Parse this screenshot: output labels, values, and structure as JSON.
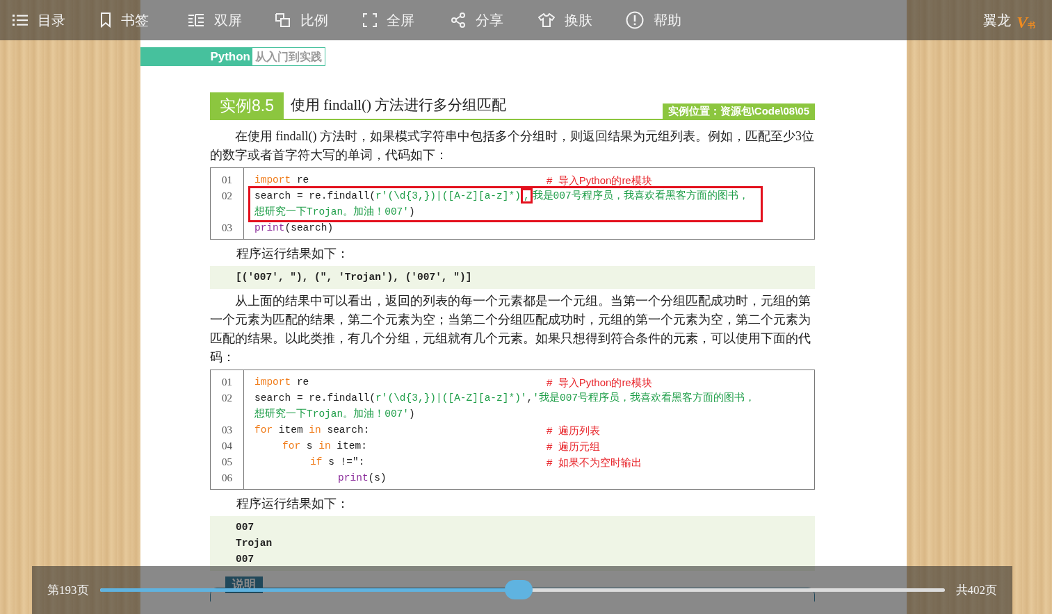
{
  "toolbar": {
    "items": [
      {
        "kind": "list",
        "label": "目录"
      },
      {
        "kind": "bookmark",
        "label": "书签"
      },
      {
        "kind": "columns",
        "label": "双屏"
      },
      {
        "kind": "squares",
        "label": "比例"
      },
      {
        "kind": "corners",
        "label": "全屏"
      },
      {
        "kind": "share",
        "label": "分享"
      },
      {
        "kind": "shirt",
        "label": "换肤"
      },
      {
        "kind": "alert",
        "label": "帮助"
      }
    ],
    "brand": "翼龙",
    "logo": {
      "letter": "V",
      "sub": "书"
    }
  },
  "page": {
    "header": {
      "book_en": "Python",
      "book_cn": "从入门到实践"
    },
    "example": {
      "label": "实例8.5",
      "title": "使用 findall() 方法进行多分组匹配",
      "location": "实例位置：资源包\\Code\\08\\05"
    },
    "blocks": [
      {
        "kind": "paragraph",
        "text": "在使用 findall() 方法时，如果模式字符串中包括多个分组时，则返回结果为元组列表。例如，匹配至少3位的数字或者首字符大写的单词，代码如下："
      },
      {
        "kind": "code",
        "lines": [
          {
            "number": "01",
            "tokens": [
              {
                "text": "import",
                "kind": "keyword"
              },
              {
                "text": " re",
                "kind": "plain"
              }
            ],
            "comment": "#  导入Python的re模块"
          },
          {
            "number": "02",
            "highlighted": true,
            "tokens": [
              {
                "text": "search = re.findall(",
                "kind": "plain"
              },
              {
                "text": "r'(\\d{3,})|([A-Z][a-z]*)",
                "kind": "string"
              },
              {
                "text": ",",
                "kind": "string",
                "marked": true
              },
              {
                "text": "我是007号程序员，我喜欢看黑客方面的图书，",
                "kind": "string"
              }
            ],
            "continuation": [
              {
                "text": "想研究一下Trojan。加油！007'",
                "kind": "string"
              },
              {
                "text": ")",
                "kind": "plain"
              }
            ]
          },
          {
            "number": "03",
            "tokens": [
              {
                "text": "print",
                "kind": "builtin"
              },
              {
                "text": "(search)",
                "kind": "plain"
              }
            ]
          }
        ]
      },
      {
        "kind": "label",
        "text": "程序运行结果如下："
      },
      {
        "kind": "output",
        "lines": [
          "[('007', \"), (\", 'Trojan'), ('007', \")]"
        ]
      },
      {
        "kind": "paragraph",
        "text": "从上面的结果中可以看出，返回的列表的每一个元素都是一个元组。当第一个分组匹配成功时，元组的第一个元素为匹配的结果，第二个元素为空；当第二个分组匹配成功时，元组的第一个元素为空，第二个元素为匹配的结果。以此类推，有几个分组，元组就有几个元素。如果只想得到符合条件的元素，可以使用下面的代码："
      },
      {
        "kind": "code",
        "lines": [
          {
            "number": "01",
            "tokens": [
              {
                "text": "import",
                "kind": "keyword"
              },
              {
                "text": " re",
                "kind": "plain"
              }
            ],
            "comment": "#  导入Python的re模块"
          },
          {
            "number": "02",
            "tokens": [
              {
                "text": "search = re.findall(",
                "kind": "plain"
              },
              {
                "text": "r'(\\d{3,})|([A-Z][a-z]*)'",
                "kind": "string"
              },
              {
                "text": ",",
                "kind": "plain"
              },
              {
                "text": "'我是007号程序员，我喜欢看黑客方面的图书，",
                "kind": "string"
              }
            ],
            "continuation": [
              {
                "text": "想研究一下Trojan。加油！007'",
                "kind": "string"
              },
              {
                "text": ")",
                "kind": "plain"
              }
            ]
          },
          {
            "number": "03",
            "tokens": [
              {
                "text": "for",
                "kind": "keyword"
              },
              {
                "text": " item ",
                "kind": "plain"
              },
              {
                "text": "in",
                "kind": "keyword"
              },
              {
                "text": " search:",
                "kind": "plain"
              }
            ],
            "comment": "#  遍历列表",
            "children": [
              {
                "number": "04",
                "tokens": [
                  {
                    "text": "for",
                    "kind": "keyword"
                  },
                  {
                    "text": " s ",
                    "kind": "plain"
                  },
                  {
                    "text": "in",
                    "kind": "keyword"
                  },
                  {
                    "text": " item:",
                    "kind": "plain"
                  }
                ],
                "comment": "#  遍历元组",
                "children": [
                  {
                    "number": "05",
                    "tokens": [
                      {
                        "text": "if",
                        "kind": "keyword"
                      },
                      {
                        "text": " s !=\":",
                        "kind": "plain"
                      }
                    ],
                    "comment": "#  如果不为空时输出",
                    "children": [
                      {
                        "number": "06",
                        "tokens": [
                          {
                            "text": "print",
                            "kind": "builtin"
                          },
                          {
                            "text": "(s)",
                            "kind": "plain"
                          }
                        ]
                      }
                    ]
                  }
                ]
              }
            ]
          }
        ]
      },
      {
        "kind": "label",
        "text": "程序运行结果如下："
      },
      {
        "kind": "output",
        "lines": [
          "007",
          "Trojan",
          "007"
        ]
      },
      {
        "kind": "note",
        "title": "说明"
      }
    ]
  },
  "footer": {
    "current": "第193页",
    "slider": {
      "level": 0.496
    },
    "total": "共402页"
  }
}
